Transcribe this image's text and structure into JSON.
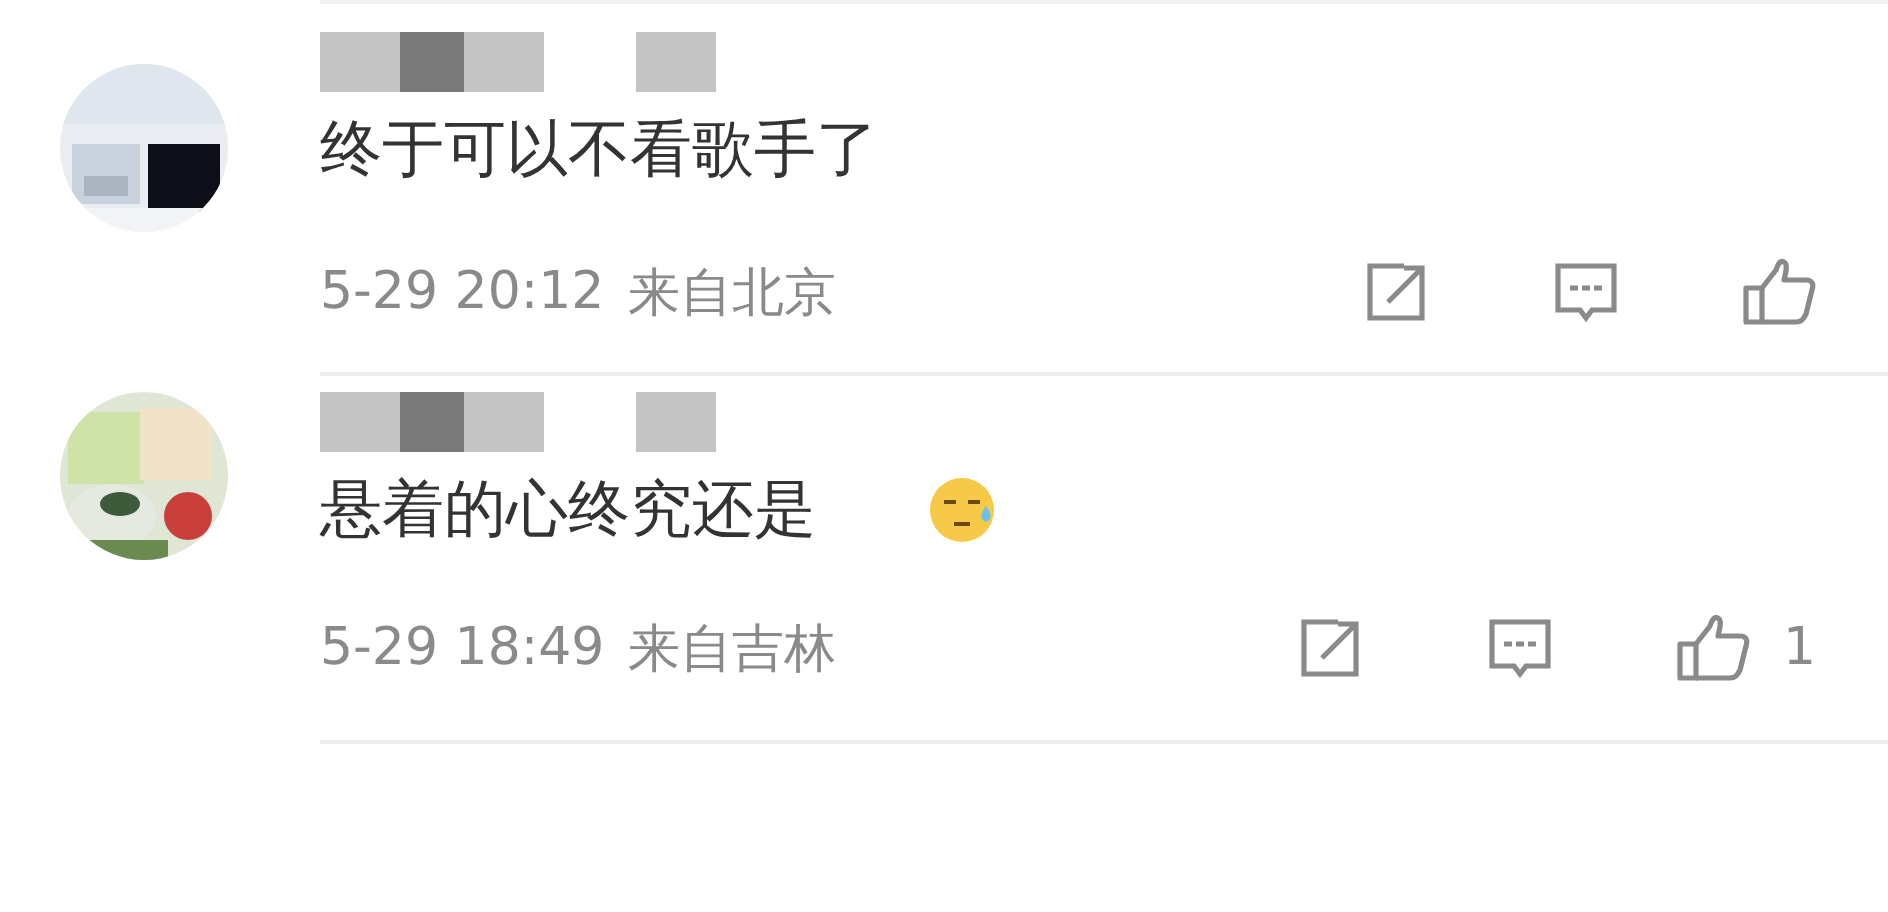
{
  "comments": [
    {
      "author": {
        "kind": "redacted"
      },
      "text": "终于可以不看歌手了",
      "time": "5-29 20:12",
      "location": "来自北京"
    },
    {
      "author": {
        "kind": "redacted"
      },
      "text": "悬着的心终究还是",
      "emoji": true,
      "time": "5-29 18:49",
      "location": "来自吉林",
      "likes": "1"
    }
  ]
}
